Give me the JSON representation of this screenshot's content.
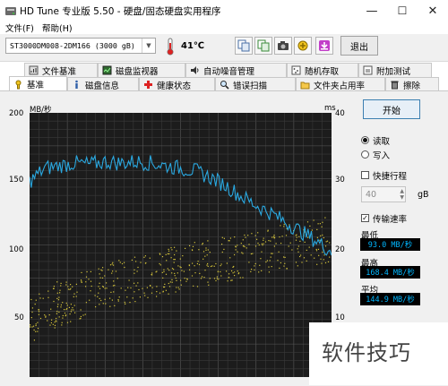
{
  "window": {
    "title": "HD Tune 专业版 5.50 - 硬盘/固态硬盘实用程序",
    "minimize": "—",
    "maximize": "☐",
    "close": "✕"
  },
  "menu": [
    "文件(F)",
    "帮助(H)"
  ],
  "toolbar": {
    "drive": "ST3000DM008-2DM166 (3000 gB)",
    "temperature": "41℃",
    "exit_label": "退出"
  },
  "tabs_top": [
    "文件基准",
    "磁盘监视器",
    "自动噪音管理",
    "随机存取",
    "附加测试"
  ],
  "tabs_bottom": [
    "基准",
    "磁盘信息",
    "健康状态",
    "错误扫描",
    "文件夹占用率",
    "擦除"
  ],
  "chart_data": {
    "type": "line",
    "left_axis_label": "MB/秒",
    "right_axis_label": "ms",
    "y_ticks_left": [
      "200",
      "150",
      "100",
      "50"
    ],
    "y_ticks_right": [
      "40",
      "30",
      "20",
      "10"
    ],
    "ylim_left": [
      0,
      200
    ],
    "ylim_right": [
      0,
      40
    ],
    "grid": true,
    "series": [
      {
        "name": "传输速率",
        "color": "#2aa8e0",
        "x": [
          0,
          0.05,
          0.1,
          0.15,
          0.2,
          0.25,
          0.3,
          0.35,
          0.4,
          0.45,
          0.5,
          0.55,
          0.6,
          0.65,
          0.7,
          0.75,
          0.8,
          0.85,
          0.9,
          0.95,
          1.0
        ],
        "values": [
          148,
          158,
          160,
          162,
          161,
          163,
          162,
          163,
          162,
          160,
          158,
          156,
          151,
          145,
          137,
          130,
          124,
          117,
          110,
          103,
          95
        ]
      }
    ],
    "access_time_scatter": {
      "color": "#d4c43a",
      "trend_start_ms": 8,
      "trend_end_ms": 21
    }
  },
  "controls": {
    "start_label": "开始",
    "read_label": "读取",
    "write_label": "写入",
    "read_selected": true,
    "quick_label": "快捷行程",
    "quick_checked": false,
    "quick_value": "40",
    "quick_unit": "gB",
    "transfer_label": "传输速率",
    "transfer_checked": true
  },
  "stats": {
    "min_label": "最低",
    "min_value": "93.0 MB/秒",
    "max_label": "最高",
    "max_value": "168.4 MB/秒",
    "avg_label": "平均",
    "avg_value": "144.9 MB/秒"
  },
  "watermark": "软件技巧"
}
